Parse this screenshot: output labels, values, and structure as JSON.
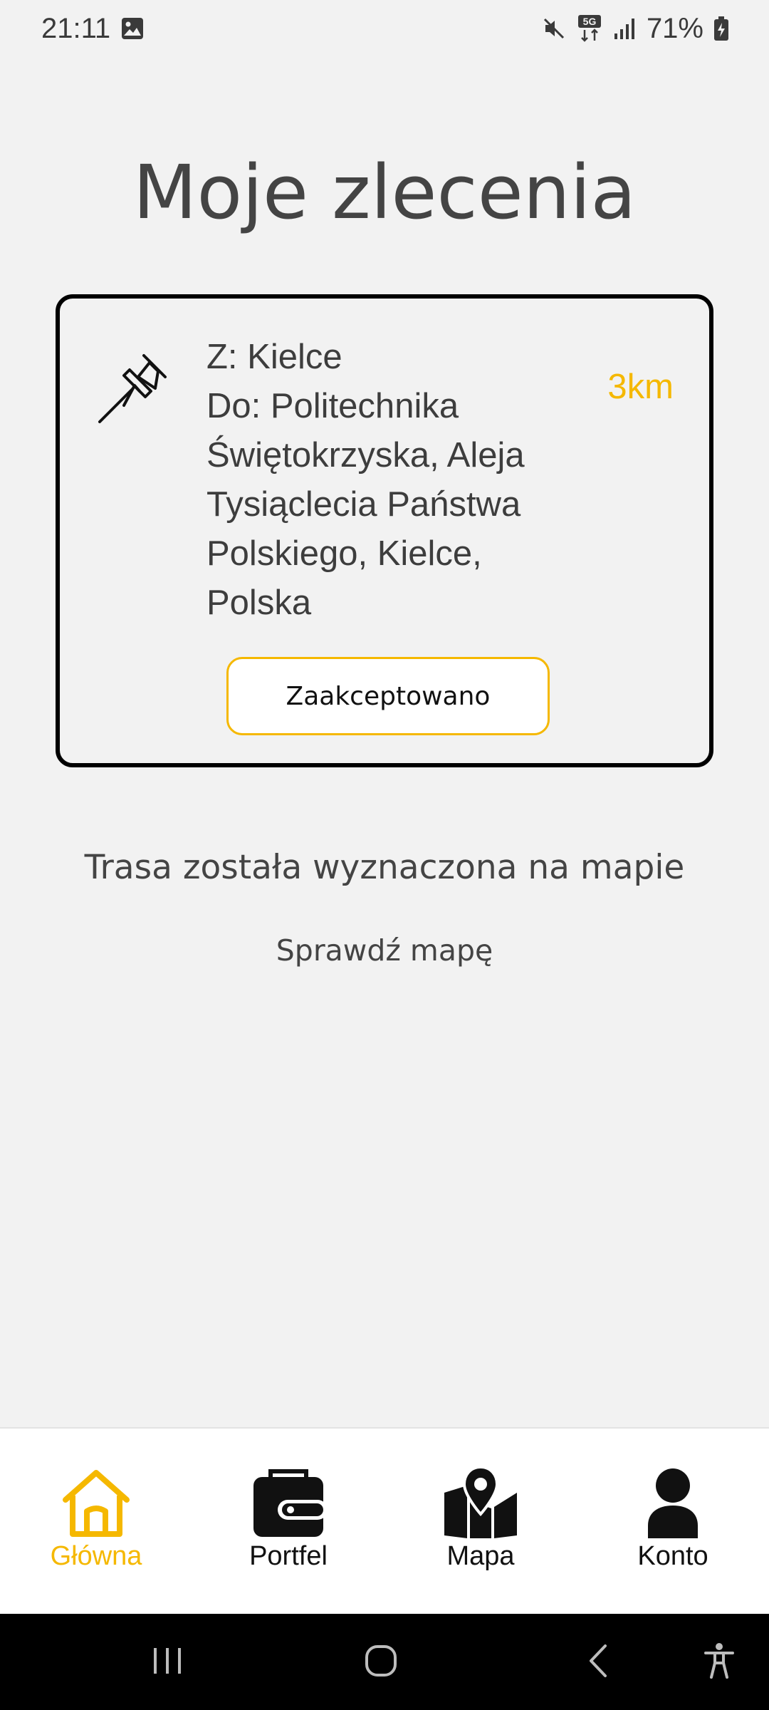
{
  "status_bar": {
    "time": "21:11",
    "battery": "71%",
    "icons": [
      "gallery-icon",
      "mute-icon",
      "5g-icon",
      "signal-icon",
      "battery-icon"
    ]
  },
  "page": {
    "title": "Moje zlecenia"
  },
  "order": {
    "from": "Z: Kielce",
    "to": "Do: Politechnika Świętokrzyska, Aleja Tysiąclecia Państwa Polskiego, Kielce, Polska",
    "distance": "3km",
    "status_button": "Zaakceptowano",
    "icon": "pushpin-icon"
  },
  "route": {
    "info": "Trasa została wyznaczona na mapie",
    "check_map": "Sprawdź mapę"
  },
  "bottom_nav": {
    "items": [
      {
        "label": "Główna",
        "icon": "home-icon",
        "active": true
      },
      {
        "label": "Portfel",
        "icon": "wallet-icon",
        "active": false
      },
      {
        "label": "Mapa",
        "icon": "map-icon",
        "active": false
      },
      {
        "label": "Konto",
        "icon": "account-icon",
        "active": false
      }
    ]
  },
  "colors": {
    "accent": "#f5b800",
    "background": "#f2f2f2",
    "text": "#444444"
  }
}
